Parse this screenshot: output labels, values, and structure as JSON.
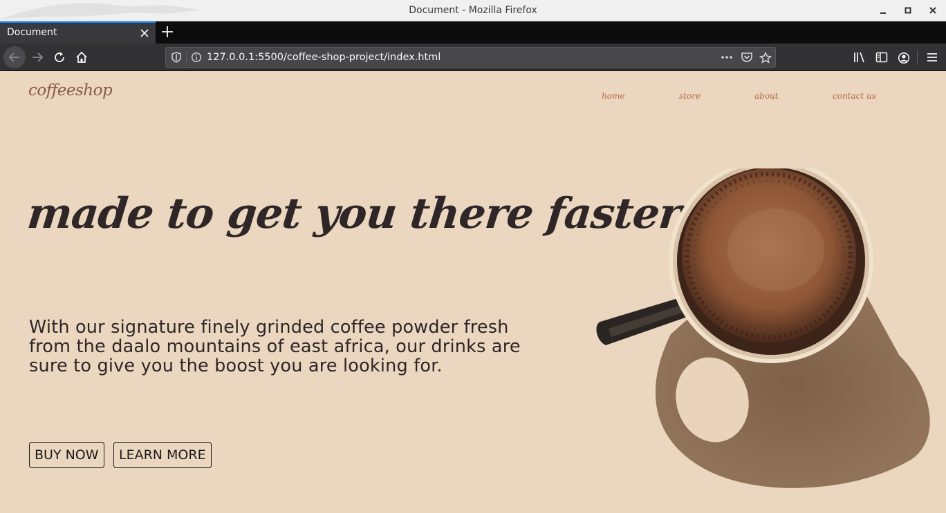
{
  "window": {
    "title": "Document - Mozilla Firefox"
  },
  "tabs": [
    {
      "label": "Document"
    }
  ],
  "toolbar": {
    "url": "127.0.0.1:5500/coffee-shop-project/index.html"
  },
  "site": {
    "logo": "coffeeshop",
    "nav": [
      {
        "label": "home"
      },
      {
        "label": "store"
      },
      {
        "label": "about"
      },
      {
        "label": "contact us"
      }
    ],
    "headline": "made to get you there faster",
    "description": "With our signature finely grinded coffee powder fresh from the daalo mountains of east africa, our drinks are sure to give you the boost you are looking for.",
    "buttons": {
      "buy": "BUY NOW",
      "learn": "LEARN MORE"
    }
  },
  "colors": {
    "background": "#ebd6bf",
    "text_dark": "#2e2627",
    "nav_link": "#b36a48",
    "logo": "#8a5a44",
    "tab_accent": "#0a84ff"
  }
}
